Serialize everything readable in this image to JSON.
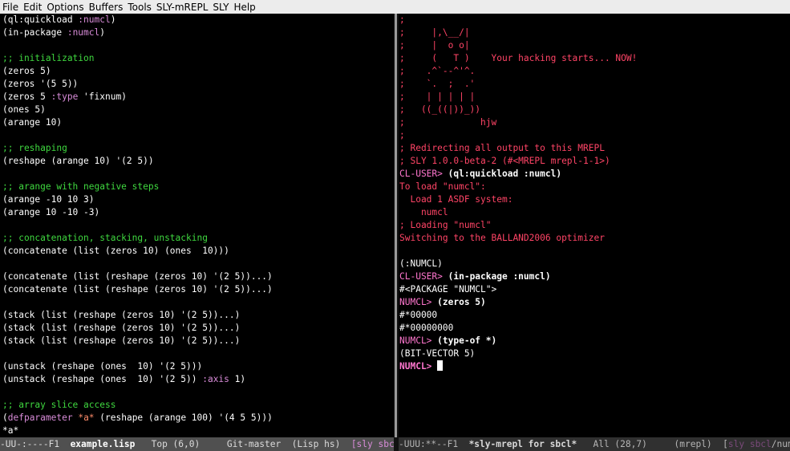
{
  "menubar": {
    "items": [
      "File",
      "Edit",
      "Options",
      "Buffers",
      "Tools",
      "SLY-mREPL",
      "SLY",
      "Help"
    ]
  },
  "colors": {
    "default_text": "#ffffff",
    "comment": "#3fd83f",
    "keyword": "#d98cd9",
    "quote": "#ff8c6a",
    "prompt": "#ff76ce",
    "repl_red": "#ff4466",
    "output": "#ffffff",
    "modeline_bg_active": "#505050",
    "modeline_bg_inactive": "#303030"
  },
  "left_buffer": {
    "lines": [
      [
        {
          "t": "(ql:quickload ",
          "c": "default_text"
        },
        {
          "t": ":numcl",
          "c": "keyword"
        },
        {
          "t": ")",
          "c": "default_text"
        }
      ],
      [
        {
          "t": "(in-package ",
          "c": "default_text"
        },
        {
          "t": ":numcl",
          "c": "keyword"
        },
        {
          "t": ")",
          "c": "default_text"
        }
      ],
      [],
      [
        {
          "t": ";; initialization",
          "c": "comment"
        }
      ],
      [
        {
          "t": "(zeros 5)",
          "c": "default_text"
        }
      ],
      [
        {
          "t": "(zeros '(5 5))",
          "c": "default_text"
        }
      ],
      [
        {
          "t": "(zeros 5 ",
          "c": "default_text"
        },
        {
          "t": ":type",
          "c": "keyword"
        },
        {
          "t": " '",
          "c": "default_text"
        },
        {
          "t": "fixnum",
          "c": "default_text"
        },
        {
          "t": ")",
          "c": "default_text"
        }
      ],
      [
        {
          "t": "(ones 5)",
          "c": "default_text"
        }
      ],
      [
        {
          "t": "(arange 10)",
          "c": "default_text"
        }
      ],
      [],
      [
        {
          "t": ";; reshaping",
          "c": "comment"
        }
      ],
      [
        {
          "t": "(reshape (arange 10) '(2 5))",
          "c": "default_text"
        }
      ],
      [],
      [
        {
          "t": ";; arange with negative steps",
          "c": "comment"
        }
      ],
      [
        {
          "t": "(arange -10 10 3)",
          "c": "default_text"
        }
      ],
      [
        {
          "t": "(arange 10 -10 -3)",
          "c": "default_text"
        }
      ],
      [],
      [
        {
          "t": ";; concatenation, stacking, unstacking",
          "c": "comment"
        }
      ],
      [
        {
          "t": "(concatenate (list (zeros 10) (ones  10)))",
          "c": "default_text"
        }
      ],
      [],
      [
        {
          "t": "(concatenate (list (reshape (zeros 10) '(2 5))...)",
          "c": "default_text"
        }
      ],
      [
        {
          "t": "(concatenate (list (reshape (zeros 10) '(2 5))...)",
          "c": "default_text"
        }
      ],
      [],
      [
        {
          "t": "(stack (list (reshape (zeros 10) '(2 5))...)",
          "c": "default_text"
        }
      ],
      [
        {
          "t": "(stack (list (reshape (zeros 10) '(2 5))...)",
          "c": "default_text"
        }
      ],
      [
        {
          "t": "(stack (list (reshape (zeros 10) '(2 5))...)",
          "c": "default_text"
        }
      ],
      [],
      [
        {
          "t": "(unstack (reshape (ones  10) '(2 5)))",
          "c": "default_text"
        }
      ],
      [
        {
          "t": "(unstack (reshape (ones  10) '(2 5)) ",
          "c": "default_text"
        },
        {
          "t": ":axis",
          "c": "keyword"
        },
        {
          "t": " 1)",
          "c": "default_text"
        }
      ],
      [],
      [
        {
          "t": ";; array slice access",
          "c": "comment"
        }
      ],
      [
        {
          "t": "(",
          "c": "default_text"
        },
        {
          "t": "defparameter",
          "c": "keyword"
        },
        {
          "t": " ",
          "c": "default_text"
        },
        {
          "t": "*a*",
          "c": "quote"
        },
        {
          "t": " (reshape (arange 100) '(4 5 5)))",
          "c": "default_text"
        }
      ],
      [
        {
          "t": "*a*",
          "c": "default_text"
        }
      ]
    ]
  },
  "right_buffer": {
    "lines": [
      [
        {
          "t": ";",
          "c": "repl_red"
        }
      ],
      [
        {
          "t": ";     |,\\__/|",
          "c": "repl_red"
        }
      ],
      [
        {
          "t": ";     |  o o|",
          "c": "repl_red"
        }
      ],
      [
        {
          "t": ";     (   T )    Your hacking starts... NOW!",
          "c": "repl_red"
        }
      ],
      [
        {
          "t": ";    .^`--^'^.",
          "c": "repl_red"
        }
      ],
      [
        {
          "t": ";    `.  ;  .'",
          "c": "repl_red"
        }
      ],
      [
        {
          "t": ";    | | | | |",
          "c": "repl_red"
        }
      ],
      [
        {
          "t": ";   ((_((|))_))",
          "c": "repl_red"
        }
      ],
      [
        {
          "t": ";              hjw",
          "c": "repl_red"
        }
      ],
      [
        {
          "t": ";",
          "c": "repl_red"
        }
      ],
      [
        {
          "t": "; Redirecting all output to this MREPL",
          "c": "repl_red"
        }
      ],
      [
        {
          "t": "; SLY 1.0.0-beta-2 (#<MREPL mrepl-1-1>)",
          "c": "repl_red"
        }
      ],
      [
        {
          "t": "CL-USER> ",
          "c": "prompt"
        },
        {
          "t": "(ql:quickload :numcl)",
          "c": "output",
          "b": true
        }
      ],
      [
        {
          "t": "To load \"numcl\":",
          "c": "repl_red"
        }
      ],
      [
        {
          "t": "  Load 1 ASDF system:",
          "c": "repl_red"
        }
      ],
      [
        {
          "t": "    numcl",
          "c": "repl_red"
        }
      ],
      [
        {
          "t": "; Loading \"numcl\"",
          "c": "repl_red"
        }
      ],
      [
        {
          "t": "Switching to the BALLAND2006 optimizer",
          "c": "repl_red"
        }
      ],
      [],
      [
        {
          "t": "(:NUMCL)",
          "c": "output"
        }
      ],
      [
        {
          "t": "CL-USER> ",
          "c": "prompt"
        },
        {
          "t": "(in-package :numcl)",
          "c": "output",
          "b": true
        }
      ],
      [
        {
          "t": "#<PACKAGE \"NUMCL\">",
          "c": "output"
        }
      ],
      [
        {
          "t": "NUMCL> ",
          "c": "prompt"
        },
        {
          "t": "(zeros 5)",
          "c": "output",
          "b": true
        }
      ],
      [
        {
          "t": "#*00000",
          "c": "output"
        }
      ],
      [
        {
          "t": "#*00000000",
          "c": "output"
        }
      ],
      [
        {
          "t": "NUMCL> ",
          "c": "prompt"
        },
        {
          "t": "(type-of *)",
          "c": "output",
          "b": true
        }
      ],
      [
        {
          "t": "(BIT-VECTOR 5)",
          "c": "output"
        }
      ],
      [
        {
          "t": "NUMCL> ",
          "c": "prompt",
          "b": true
        }
      ]
    ]
  },
  "modeline_left": {
    "segments": [
      {
        "t": "-UU-:----F1  ",
        "c": "#dcdcdc"
      },
      {
        "t": "example.lisp",
        "c": "#ffffff",
        "b": true
      },
      {
        "t": "   Top (6,0)     Git-master  (Lisp hs)  ",
        "c": "#dcdcdc"
      },
      {
        "t": "[sly sbcl",
        "c": "#d98cd9"
      }
    ]
  },
  "modeline_right": {
    "segments": [
      {
        "t": "-UUU:**--F1  ",
        "c": "#b5b5b5"
      },
      {
        "t": "*sly-mrepl for sbcl*",
        "c": "#d8d8d8",
        "b": true
      },
      {
        "t": "   All (28,7)     (mrepl)  ",
        "c": "#b5b5b5"
      },
      {
        "t": "[",
        "c": "#b5b5b5"
      },
      {
        "t": "sly sbcl",
        "c": "#7a4a7a"
      },
      {
        "t": "/numc",
        "c": "#b5b5b5"
      }
    ]
  }
}
